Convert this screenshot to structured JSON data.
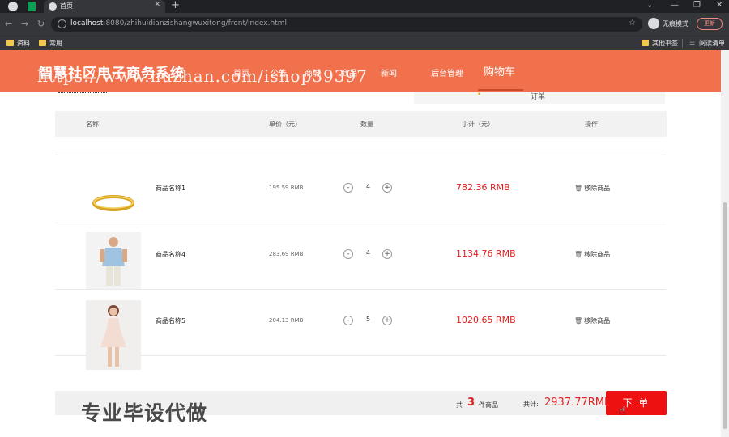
{
  "browser": {
    "tab_title": "首页",
    "url_host": "localhost",
    "url_rest": ":8080/zhihuidianzishangwuxitong/front/index.html",
    "incognito_label": "无痕模式",
    "update_label": "更新",
    "bookmarks": [
      "资料",
      "常用"
    ],
    "bookmarks_right": [
      "其他书签",
      "阅读清单"
    ]
  },
  "site": {
    "title": "智慧社区电子商务系统",
    "nav": [
      "首页",
      "公告",
      "商城",
      "商品",
      "新闻",
      "后台管理"
    ],
    "nav_active": "购物车",
    "watermark_url": "https://www.huzhan.com/ishop39397"
  },
  "cart": {
    "sub_tab_label": "订单",
    "sub_tab_dot": "•",
    "headers": {
      "name": "名称",
      "unit_price": "单价（元）",
      "quantity": "数量",
      "subtotal": "小计（元）",
      "action": "操作"
    },
    "items": [
      {
        "name": "商品名称1",
        "price": "195.59 RMB",
        "qty": "4",
        "subtotal": "782.36 RMB",
        "remove": "移除商品",
        "image_icon": "gold-bangle"
      },
      {
        "name": "商品名称4",
        "price": "283.69 RMB",
        "qty": "4",
        "subtotal": "1134.76 RMB",
        "remove": "移除商品",
        "image_icon": "man-shirt"
      },
      {
        "name": "商品名称5",
        "price": "204.13 RMB",
        "qty": "5",
        "subtotal": "1020.65 RMB",
        "remove": "移除商品",
        "image_icon": "woman-dress"
      }
    ],
    "summary": {
      "count_prefix": "共",
      "count": "3",
      "count_suffix": "件商品",
      "total_label": "共计:",
      "total_value": "2937.77RMB",
      "order_button": "下 单"
    }
  },
  "overlay": {
    "watermark_text": "专业毕设代做"
  },
  "colors": {
    "header": "#f0714c",
    "price_red": "#e02020",
    "order_button": "#ee1111"
  }
}
